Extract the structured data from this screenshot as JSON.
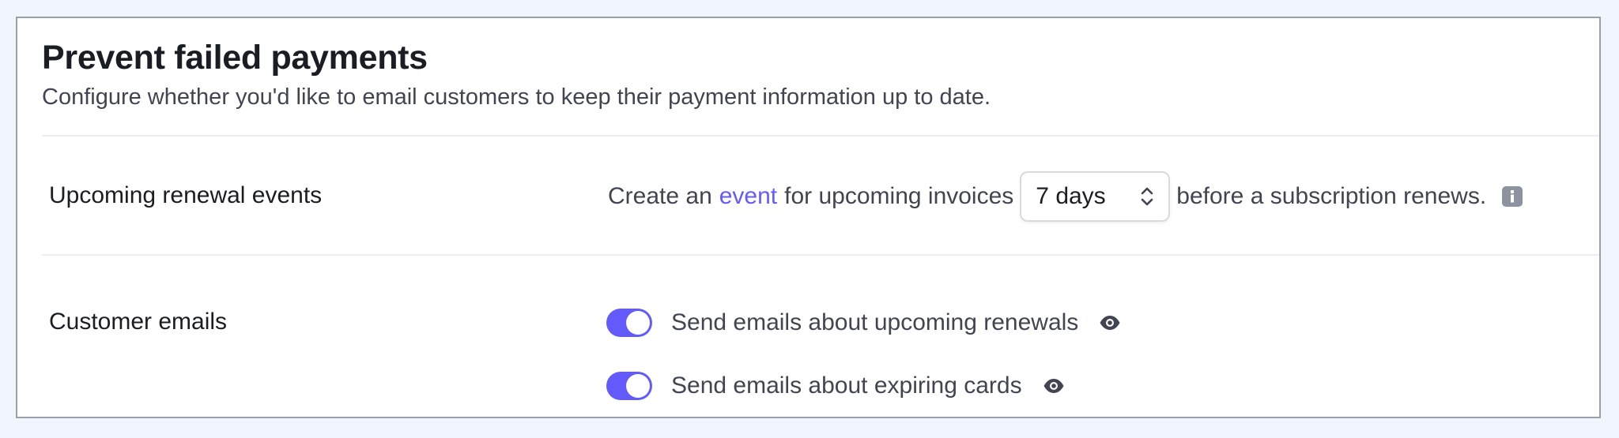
{
  "header": {
    "title": "Prevent failed payments",
    "subtitle": "Configure whether you'd like to email customers to keep their payment information up to date."
  },
  "renewal": {
    "label": "Upcoming renewal events",
    "text_before": "Create an",
    "link_text": "event",
    "text_middle": "for upcoming invoices",
    "select_value": "7 days",
    "text_after": "before a subscription renews.",
    "info_icon": "info-icon"
  },
  "emails": {
    "label": "Customer emails",
    "toggles": [
      {
        "label": "Send emails about upcoming renewals",
        "enabled": true,
        "preview_icon": "eye-icon"
      },
      {
        "label": "Send emails about expiring cards",
        "enabled": true,
        "preview_icon": "eye-icon"
      }
    ]
  },
  "colors": {
    "accent": "#635bff",
    "toggle_on": "#625afa",
    "page_background": "#f1f5fd",
    "heading_text": "#1a1d24",
    "body_text": "#414552"
  }
}
